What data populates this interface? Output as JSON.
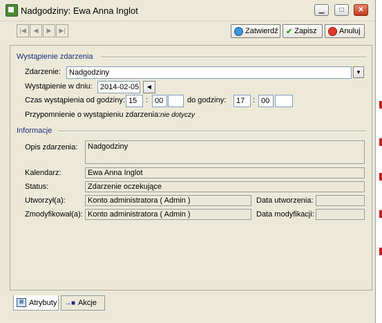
{
  "window": {
    "title": "Nadgodziny: Ewa Anna Inglot",
    "icons": [
      "app-icon",
      "minimize-icon",
      "maximize-icon",
      "close-icon"
    ]
  },
  "toolbar": {
    "nav": [
      "first-record-icon",
      "previous-record-icon",
      "next-record-icon",
      "last-record-icon"
    ],
    "confirm_label": "Zatwierdź",
    "save_label": "Zapisz",
    "cancel_label": "Anuluj"
  },
  "section_event": {
    "heading": "Wystąpienie zdarzenia",
    "event_label": "Zdarzenie:",
    "event_value": "Nadgodziny",
    "date_label": "Wystąpienie w dniu:",
    "date_value": "2014-02-05",
    "time_label": "Czas wystąpienia od godziny:",
    "from_hour": "15",
    "from_min": "00",
    "colon": ":",
    "to_label": "do godziny:",
    "to_hour": "17",
    "to_min": "00",
    "reminder_label": "Przypomnienie o wystąpieniu zdarzenia:",
    "reminder_value": "nie dotyczy"
  },
  "section_info": {
    "heading": "Informacje",
    "desc_label": "Opis zdarzenia:",
    "desc_value": "Nadgodziny",
    "calendar_label": "Kalendarz:",
    "calendar_value": "Ewa Anna Inglot",
    "status_label": "Status:",
    "status_value": "Zdarzenie oczekujące",
    "created_by_label": "Utworzył(a):",
    "created_by_value": "Konto administratora ( Admin )",
    "created_date_label": "Data utworzenia:",
    "created_date_value": "",
    "modified_by_label": "Zmodyfikował(a):",
    "modified_by_value": "Konto administratora ( Admin )",
    "modified_date_label": "Data modyfikacji:",
    "modified_date_value": ""
  },
  "tabs": [
    {
      "label": "Atrybuty"
    },
    {
      "label": "Akcje"
    }
  ],
  "colors": {
    "accent_section": "#1c2c7a",
    "close_button": "#c03c1e"
  }
}
